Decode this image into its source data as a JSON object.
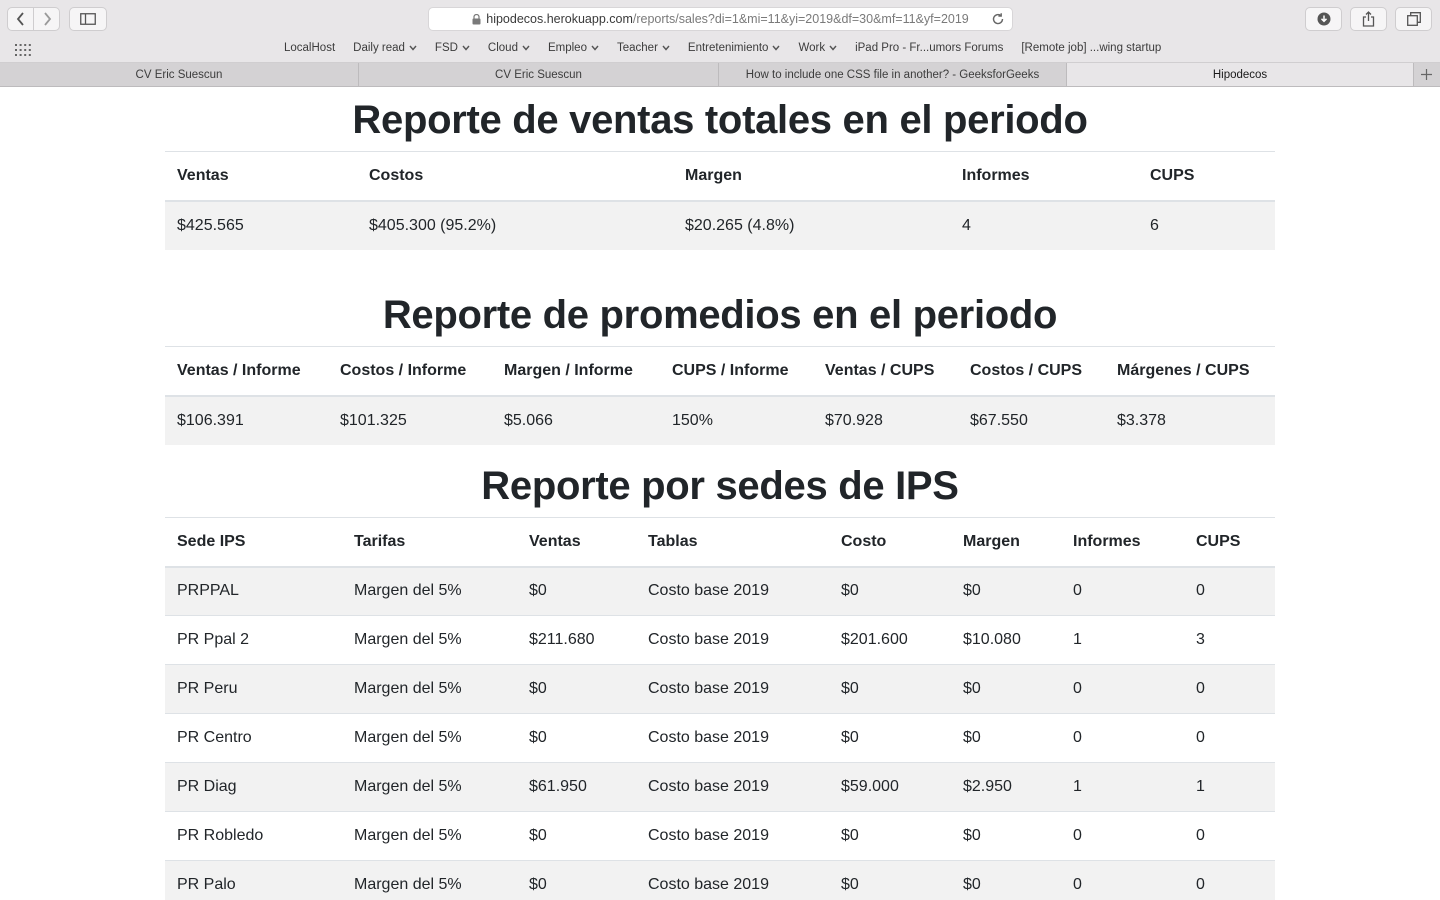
{
  "browser": {
    "url_host": "hipodecos.herokuapp.com",
    "url_path": "/reports/sales?di=1&mi=11&yi=2019&df=30&mf=11&yf=2019",
    "bookmarks": [
      {
        "label": "LocalHost",
        "dropdown": false
      },
      {
        "label": "Daily read",
        "dropdown": true
      },
      {
        "label": "FSD",
        "dropdown": true
      },
      {
        "label": "Cloud",
        "dropdown": true
      },
      {
        "label": "Empleo",
        "dropdown": true
      },
      {
        "label": "Teacher",
        "dropdown": true
      },
      {
        "label": "Entretenimiento",
        "dropdown": true
      },
      {
        "label": "Work",
        "dropdown": true
      },
      {
        "label": "iPad Pro - Fr...umors Forums",
        "dropdown": false
      },
      {
        "label": "[Remote job] ...wing startup",
        "dropdown": false
      }
    ],
    "tabs": [
      {
        "label": "CV Eric Suescun",
        "active": false
      },
      {
        "label": "CV Eric Suescun",
        "active": false
      },
      {
        "label": "How to include one CSS file in another? - GeeksforGeeks",
        "active": false
      },
      {
        "label": "Hipodecos",
        "active": true
      }
    ]
  },
  "totals": {
    "title": "Reporte de ventas totales en el periodo",
    "headers": [
      "Ventas",
      "Costos",
      "Margen",
      "Informes",
      "CUPS"
    ],
    "rows": [
      [
        "$425.565",
        "$405.300 (95.2%)",
        "$20.265 (4.8%)",
        "4",
        "6"
      ]
    ]
  },
  "averages": {
    "title": "Reporte de promedios en el periodo",
    "headers": [
      "Ventas / Informe",
      "Costos / Informe",
      "Margen / Informe",
      "CUPS / Informe",
      "Ventas / CUPS",
      "Costos / CUPS",
      "Márgenes / CUPS"
    ],
    "rows": [
      [
        "$106.391",
        "$101.325",
        "$5.066",
        "150%",
        "$70.928",
        "$67.550",
        "$3.378"
      ]
    ]
  },
  "sedes": {
    "title": "Reporte por sedes de IPS",
    "headers": [
      "Sede IPS",
      "Tarifas",
      "Ventas",
      "Tablas",
      "Costo",
      "Margen",
      "Informes",
      "CUPS"
    ],
    "rows": [
      [
        "PRPPAL",
        "Margen del 5%",
        "$0",
        "Costo base 2019",
        "$0",
        "$0",
        "0",
        "0"
      ],
      [
        "PR Ppal 2",
        "Margen del 5%",
        "$211.680",
        "Costo base 2019",
        "$201.600",
        "$10.080",
        "1",
        "3"
      ],
      [
        "PR Peru",
        "Margen del 5%",
        "$0",
        "Costo base 2019",
        "$0",
        "$0",
        "0",
        "0"
      ],
      [
        "PR Centro",
        "Margen del 5%",
        "$0",
        "Costo base 2019",
        "$0",
        "$0",
        "0",
        "0"
      ],
      [
        "PR Diag",
        "Margen del 5%",
        "$61.950",
        "Costo base 2019",
        "$59.000",
        "$2.950",
        "1",
        "1"
      ],
      [
        "PR Robledo",
        "Margen del 5%",
        "$0",
        "Costo base 2019",
        "$0",
        "$0",
        "0",
        "0"
      ],
      [
        "PR Palo",
        "Margen del 5%",
        "$0",
        "Costo base 2019",
        "$0",
        "$0",
        "0",
        "0"
      ]
    ]
  }
}
